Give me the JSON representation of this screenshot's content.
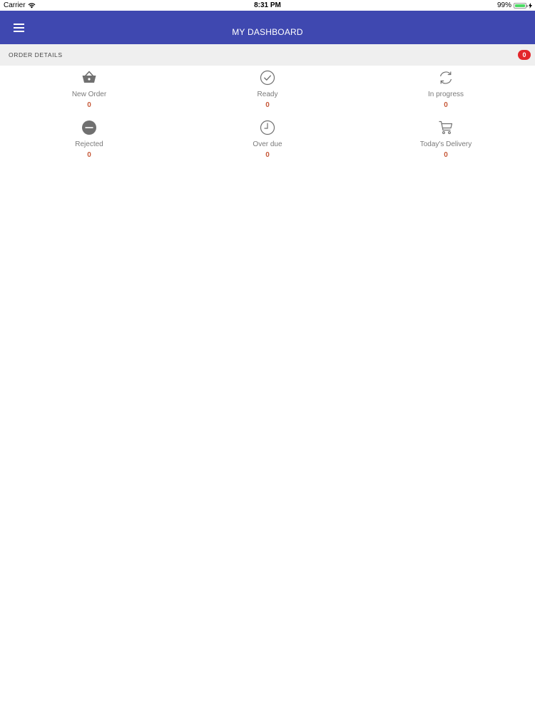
{
  "status_bar": {
    "carrier": "Carrier",
    "time": "8:31 PM",
    "battery": "99%",
    "battery_level": 0.99
  },
  "app_bar": {
    "title": "MY DASHBOARD",
    "menu_icon": "hamburger-menu-icon"
  },
  "order_details": {
    "title": "ORDER DETAILS",
    "badge_count": "0",
    "tiles": [
      {
        "label": "New Order",
        "count": "0",
        "icon": "basket-icon"
      },
      {
        "label": "Ready",
        "count": "0",
        "icon": "check-circle-icon"
      },
      {
        "label": "In progress",
        "count": "0",
        "icon": "refresh-icon"
      },
      {
        "label": "Rejected",
        "count": "0",
        "icon": "minus-circle-icon"
      },
      {
        "label": "Over due",
        "count": "0",
        "icon": "clock-icon"
      },
      {
        "label": "Today's Delivery",
        "count": "0",
        "icon": "cart-icon"
      }
    ]
  },
  "colors": {
    "app_bar": "#3f48b0",
    "badge": "#e3262a",
    "count_text": "#c75a3a",
    "label_text": "#7a7a7a"
  }
}
